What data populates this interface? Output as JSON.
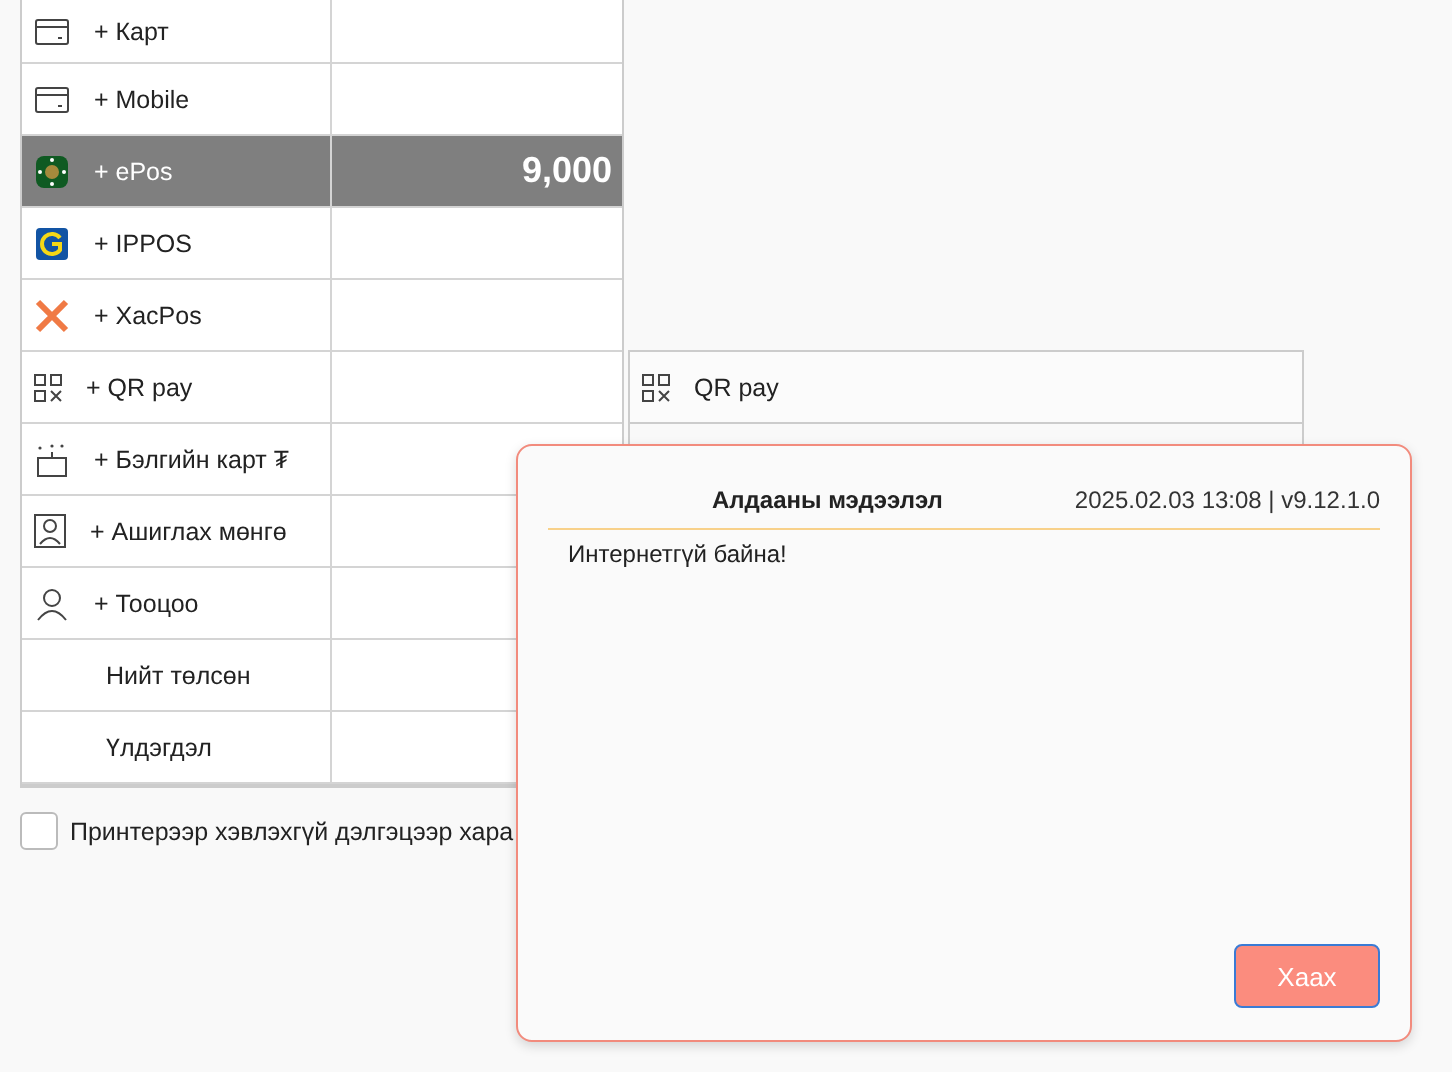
{
  "payments": [
    {
      "kind": "card",
      "label": "+ Карт",
      "selected": false
    },
    {
      "kind": "card",
      "label": "+ Mobile",
      "selected": false
    },
    {
      "kind": "epos",
      "label": "+ ePos",
      "amount": "9,000",
      "selected": true
    },
    {
      "kind": "ippos",
      "label": "+ IPPOS",
      "selected": false
    },
    {
      "kind": "xacpos",
      "label": "+ XacPos",
      "selected": false
    },
    {
      "kind": "qr",
      "label": "+ QR pay",
      "selected": false
    },
    {
      "kind": "gift",
      "label": "+ Бэлгийн карт ₮",
      "selected": false
    },
    {
      "kind": "badge",
      "label": "+ Ашиглах мөнгө",
      "selected": false
    },
    {
      "kind": "person",
      "label": "+ Тооцоо",
      "selected": false
    }
  ],
  "summary": [
    {
      "label": "Нийт төлсөн"
    },
    {
      "label": "Үлдэгдэл"
    }
  ],
  "screen_only": {
    "label": "Принтерээр хэвлэхгүй дэлгэцээр хара",
    "checked": false
  },
  "side_options": [
    {
      "kind": "qr",
      "label": "QR pay"
    }
  ],
  "dialog": {
    "title": "Алдааны мэдээлэл",
    "timestamp": "2025.02.03 13:08 | v9.12.1.0",
    "message": "Интернетгүй байна!",
    "button": "Хаах"
  }
}
